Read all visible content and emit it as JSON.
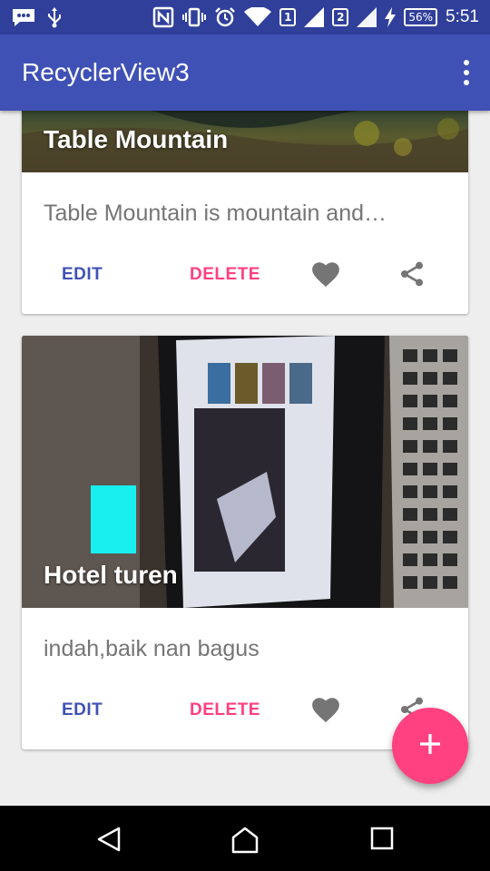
{
  "status_bar": {
    "battery_percent": "56%",
    "sim1": "1",
    "sim2": "2",
    "time": "5:51",
    "icons": [
      "messages-icon",
      "usb-icon",
      "nfc-icon",
      "vibrate-icon",
      "alarm-icon",
      "wifi-icon",
      "signal-icon",
      "signal-icon",
      "charging-icon",
      "battery-icon"
    ]
  },
  "app_bar": {
    "title": "RecyclerView3",
    "overflow_icon": "more-vert-icon",
    "color": "#3f51b5"
  },
  "cards": [
    {
      "title": "Table Mountain",
      "description": "Table Mountain is mountain and…",
      "edit_label": "EDIT",
      "delete_label": "DELETE",
      "like_icon": "heart-icon",
      "share_icon": "share-icon"
    },
    {
      "title": "Hotel turen",
      "description": "indah,baik nan bagus",
      "edit_label": "EDIT",
      "delete_label": "DELETE",
      "like_icon": "heart-icon",
      "share_icon": "share-icon"
    }
  ],
  "fab": {
    "icon": "add-icon",
    "color": "#ff4081"
  },
  "nav_bar": {
    "icons": [
      "back-icon",
      "home-icon",
      "recents-icon"
    ]
  },
  "colors": {
    "primary": "#3f51b5",
    "primary_dark": "#2f3f9a",
    "accent": "#ff4081"
  }
}
